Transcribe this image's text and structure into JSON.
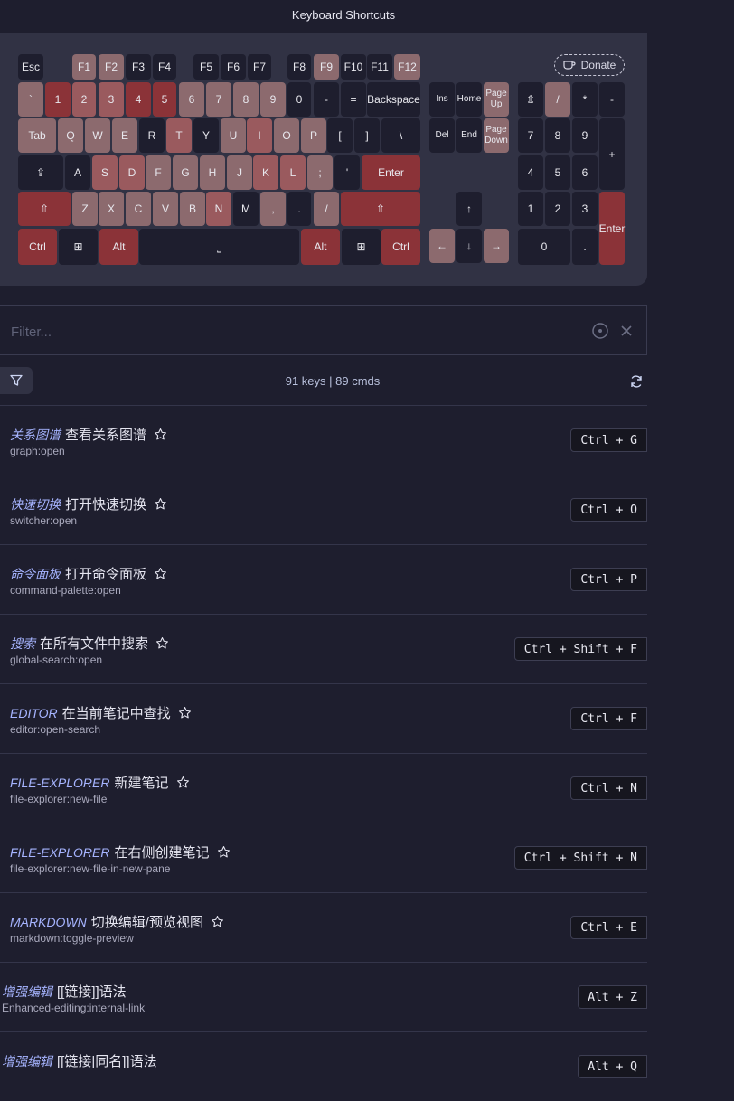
{
  "window": {
    "title": "Keyboard Shortcuts"
  },
  "donate": {
    "label": "Donate"
  },
  "keyboard": {
    "keys": [
      "Esc",
      "F1",
      "F2",
      "F3",
      "F4",
      "F5",
      "F6",
      "F7",
      "F8",
      "F9",
      "F10",
      "F11",
      "F12",
      "`",
      "1",
      "2",
      "3",
      "4",
      "5",
      "6",
      "7",
      "8",
      "9",
      "0",
      "-",
      "=",
      "Backspace",
      "Tab",
      "Q",
      "W",
      "E",
      "R",
      "T",
      "Y",
      "U",
      "I",
      "O",
      "P",
      "[",
      "]",
      "\\",
      "⇪",
      "A",
      "S",
      "D",
      "F",
      "G",
      "H",
      "J",
      "K",
      "L",
      ";",
      "'",
      "Enter",
      "⇧",
      "Z",
      "X",
      "C",
      "V",
      "B",
      "N",
      "M",
      ",",
      ".",
      "/",
      "⇧",
      "Ctrl",
      "⊞",
      "Alt",
      "⎵",
      "Alt",
      "⊞",
      "Ctrl",
      "Ins",
      "Home",
      "Page Up",
      "Del",
      "End",
      "Page Down",
      "↑",
      "←",
      "↓",
      "→",
      "⇭",
      "/",
      "*",
      "-",
      "7",
      "8",
      "9",
      "+",
      "4",
      "5",
      "6",
      "1",
      "2",
      "3",
      "Enter",
      "0",
      "."
    ]
  },
  "filter": {
    "placeholder": "Filter..."
  },
  "stats": {
    "text": "91 keys | 89 cmds"
  },
  "commands": [
    {
      "group": "关系图谱",
      "name": "查看关系图谱",
      "id": "graph:open",
      "hotkey": "Ctrl + G",
      "star": true
    },
    {
      "group": "快速切换",
      "name": "打开快速切换",
      "id": "switcher:open",
      "hotkey": "Ctrl + O",
      "star": true
    },
    {
      "group": "命令面板",
      "name": "打开命令面板",
      "id": "command-palette:open",
      "hotkey": "Ctrl + P",
      "star": true
    },
    {
      "group": "搜索",
      "name": "在所有文件中搜索",
      "id": "global-search:open",
      "hotkey": "Ctrl + Shift + F",
      "star": true
    },
    {
      "group": "EDITOR",
      "name": "在当前笔记中查找",
      "id": "editor:open-search",
      "hotkey": "Ctrl + F",
      "star": true
    },
    {
      "group": "FILE-EXPLORER",
      "name": "新建笔记",
      "id": "file-explorer:new-file",
      "hotkey": "Ctrl + N",
      "star": true
    },
    {
      "group": "FILE-EXPLORER",
      "name": "在右侧创建笔记",
      "id": "file-explorer:new-file-in-new-pane",
      "hotkey": "Ctrl + Shift + N",
      "star": true
    },
    {
      "group": "MARKDOWN",
      "name": "切换编辑/预览视图",
      "id": "markdown:toggle-preview",
      "hotkey": "Ctrl + E",
      "star": true
    },
    {
      "group": "增强编辑",
      "name": "[[链接]]语法",
      "id": "Enhanced-editing:internal-link",
      "hotkey": "Alt + Z",
      "star": false
    },
    {
      "group": "增强编辑",
      "name": "[[链接|同名]]语法",
      "id": "",
      "hotkey": "Alt + Q",
      "star": false
    }
  ]
}
